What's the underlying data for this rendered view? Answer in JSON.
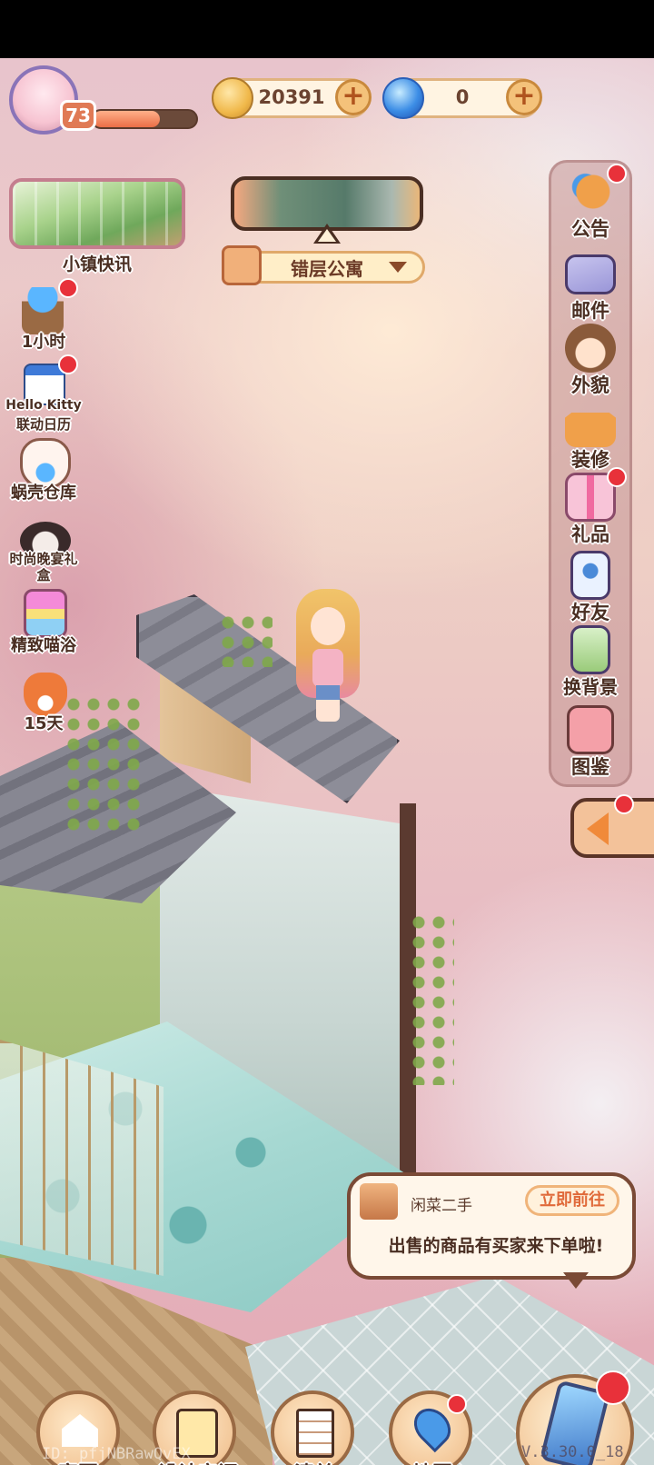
{
  "player": {
    "level": "73",
    "xp_fraction": 0.65
  },
  "currency": {
    "coins": "20391",
    "gems": "0",
    "plus": "+"
  },
  "news": {
    "label": "小镇快讯"
  },
  "left_items": [
    {
      "label": "1小时"
    },
    {
      "label_line1": "Hello Kitty",
      "label_line2": "联动日历"
    },
    {
      "label": "蜗壳仓库"
    },
    {
      "label_line1": "时尚晚宴礼",
      "label_line2": "盒"
    },
    {
      "label": "精致喵浴"
    },
    {
      "label": "15天"
    }
  ],
  "location": {
    "name": "错层公寓"
  },
  "right_menu": [
    {
      "label": "公告",
      "badge": true
    },
    {
      "label": "邮件",
      "badge": false
    },
    {
      "label": "外貌",
      "badge": false
    },
    {
      "label": "装修",
      "badge": false
    },
    {
      "label": "礼品",
      "badge": true
    },
    {
      "label": "好友",
      "badge": false
    },
    {
      "label": "换背景",
      "badge": false
    },
    {
      "label": "图鉴",
      "badge": false
    }
  ],
  "toast": {
    "title": "闲菜二手",
    "button": "立即前往",
    "message": "出售的商品有买家来下单啦!"
  },
  "bottom_nav": [
    {
      "label": "家园"
    },
    {
      "label": "设计空间"
    },
    {
      "label": "清单"
    },
    {
      "label": "地图"
    },
    {
      "label": "手机"
    }
  ],
  "footer": {
    "id": "ID: pfjNBRawQvEX",
    "version": "V.3.30.0_18"
  },
  "colors": {
    "badge_red": "#e8313a",
    "label_brown": "#4a2e22",
    "accent_orange": "#e06a3a"
  }
}
